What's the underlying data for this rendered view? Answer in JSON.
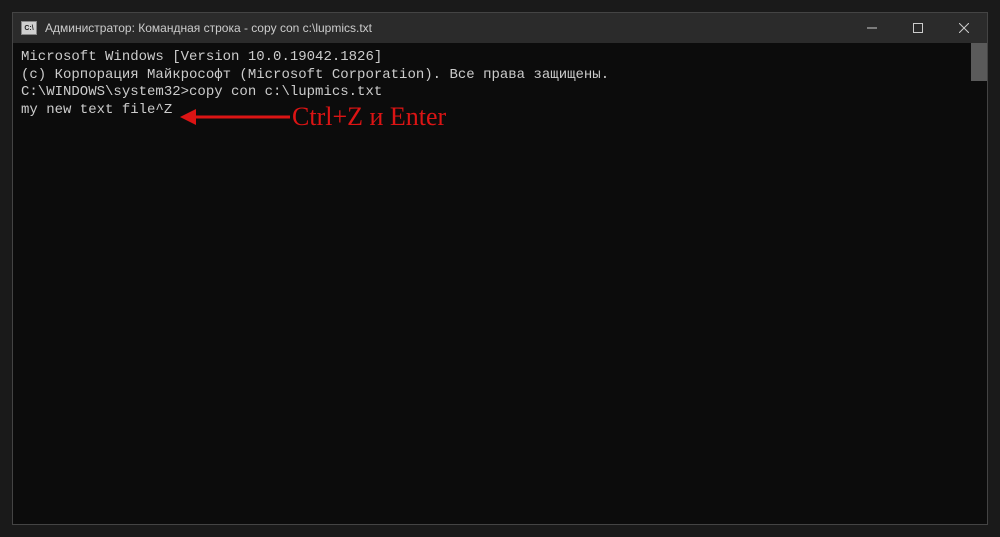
{
  "titlebar": {
    "icon_label": "C:\\",
    "title": "Администратор: Командная строка - copy  con c:\\lupmics.txt"
  },
  "terminal": {
    "line1": "Microsoft Windows [Version 10.0.19042.1826]",
    "line2": "(c) Корпорация Майкрософт (Microsoft Corporation). Все права защищены.",
    "blank": "",
    "prompt_line": "C:\\WINDOWS\\system32>copy con c:\\lupmics.txt",
    "input_line": "my new text file^Z"
  },
  "annotation": {
    "text": "Ctrl+Z и Enter",
    "arrow_color": "#dc1414"
  }
}
